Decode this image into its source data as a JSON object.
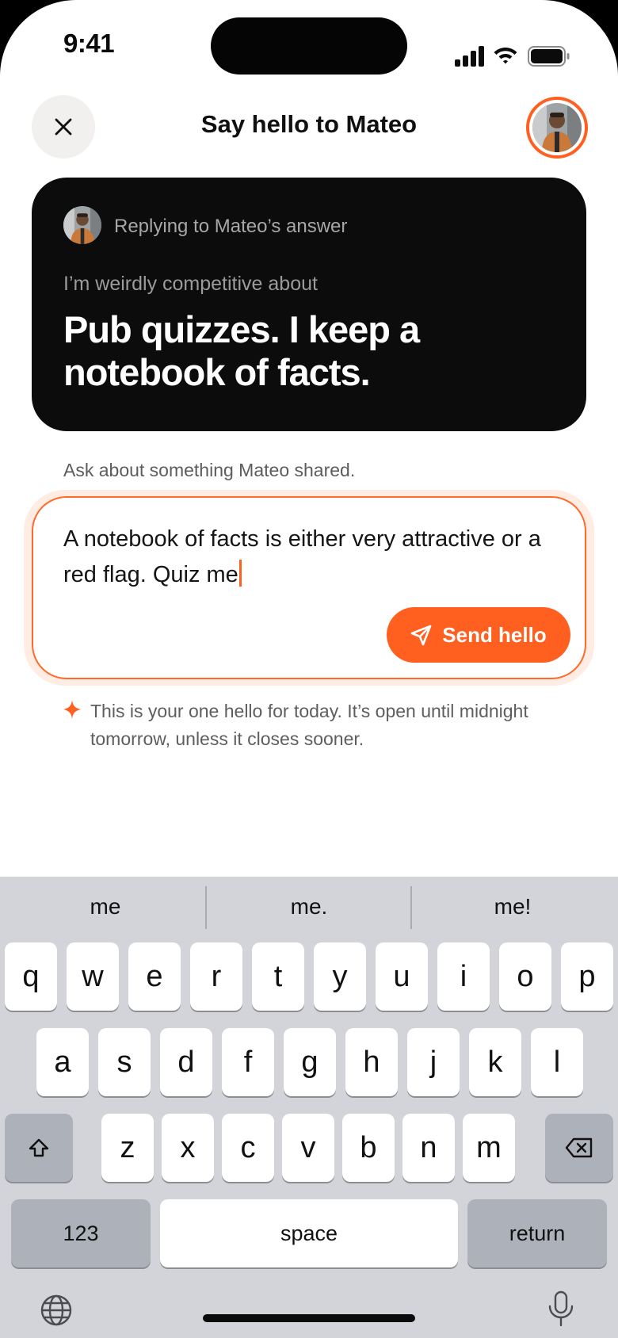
{
  "status": {
    "time": "9:41"
  },
  "header": {
    "title": "Say hello to Mateo"
  },
  "answer_card": {
    "reply_label": "Replying to Mateo’s answer",
    "prompt": "I’m weirdly competitive about",
    "answer": "Pub quizzes. I keep a notebook of facts."
  },
  "helper": "Ask about something Mateo shared.",
  "composer": {
    "message": "A notebook of facts is either very attractive or a red flag. Quiz me",
    "send_label": "Send hello"
  },
  "note": "This is your one hello for today. It’s open until midnight tomorrow, unless it closes sooner.",
  "keyboard": {
    "suggestions": [
      "me",
      "me.",
      "me!"
    ],
    "row1": [
      "q",
      "w",
      "e",
      "r",
      "t",
      "y",
      "u",
      "i",
      "o",
      "p"
    ],
    "row2": [
      "a",
      "s",
      "d",
      "f",
      "g",
      "h",
      "j",
      "k",
      "l"
    ],
    "row3": [
      "z",
      "x",
      "c",
      "v",
      "b",
      "n",
      "m"
    ],
    "numbers_label": "123",
    "space_label": "space",
    "return_label": "return"
  },
  "colors": {
    "accent": "#ff5f1f",
    "card": "#0c0c0c",
    "keyboard": "#d2d4d9"
  }
}
